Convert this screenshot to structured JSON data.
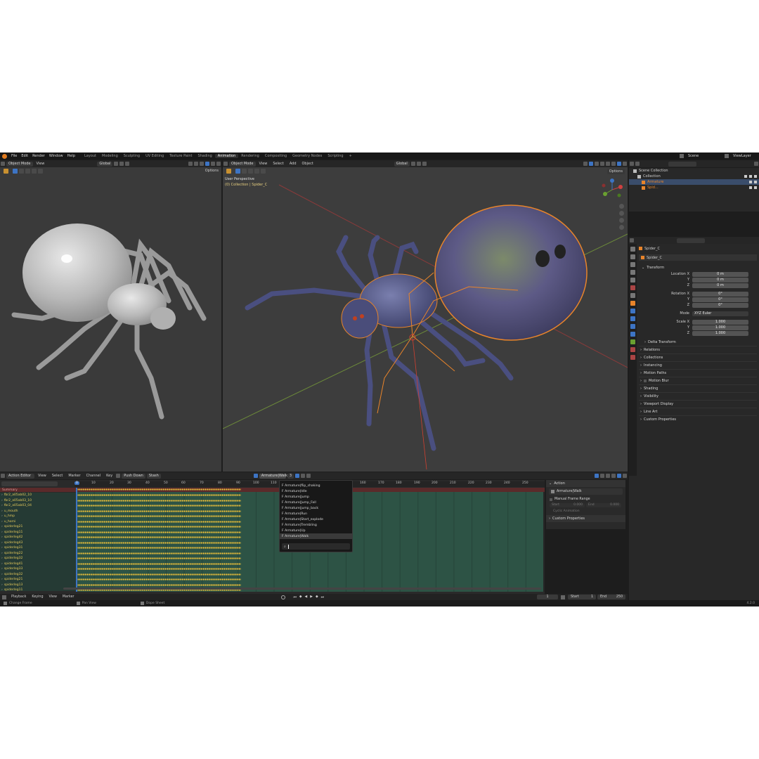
{
  "menu": {
    "items": [
      "File",
      "Edit",
      "Render",
      "Window",
      "Help"
    ],
    "workspaces": [
      "Layout",
      "Modeling",
      "Sculpting",
      "UV Editing",
      "Texture Paint",
      "Shading",
      "Animation",
      "Rendering",
      "Compositing",
      "Geometry Nodes",
      "Scripting"
    ],
    "active_workspace": "Animation",
    "scene_label": "Scene",
    "view_layer_label": "ViewLayer"
  },
  "left_view": {
    "mode": "Object Mode",
    "view_label": "View",
    "transform": "Global",
    "options": "Options"
  },
  "main_view": {
    "mode": "Object Mode",
    "menus": [
      "View",
      "Select",
      "Add",
      "Object"
    ],
    "transform": "Global",
    "options": "Options",
    "overlay_line1": "User Perspective",
    "overlay_line2": "(0) Collection | Spider_C"
  },
  "outliner": {
    "search_placeholder": "",
    "rows": [
      {
        "label": "Scene Collection",
        "indent": 0
      },
      {
        "label": "Collection",
        "indent": 1
      },
      {
        "label": "Armature",
        "indent": 2,
        "selected": true
      },
      {
        "label": "Spid...",
        "indent": 2
      }
    ]
  },
  "properties": {
    "object_name": "Spider_C",
    "object_name_field": "Spider_C",
    "transform_title": "Transform",
    "location": [
      {
        "label": "Location X",
        "value": "0 m"
      },
      {
        "label": "Y",
        "value": "0 m"
      },
      {
        "label": "Z",
        "value": "0 m"
      }
    ],
    "rotation": [
      {
        "label": "Rotation X",
        "value": "0°"
      },
      {
        "label": "Y",
        "value": "0°"
      },
      {
        "label": "Z",
        "value": "0°"
      }
    ],
    "mode_label": "Mode",
    "mode_value": "XYZ Euler",
    "scale": [
      {
        "label": "Scale X",
        "value": "1.000"
      },
      {
        "label": "Y",
        "value": "1.000"
      },
      {
        "label": "Z",
        "value": "1.000"
      }
    ],
    "delta_transform": "Delta Transform",
    "sections": [
      "Relations",
      "Collections",
      "Instancing",
      "Motion Paths",
      "Motion Blur",
      "Shading",
      "Visibility",
      "Viewport Display",
      "Line Art",
      "Custom Properties"
    ]
  },
  "action_editor": {
    "editor_label": "Action Editor",
    "menus": [
      "View",
      "Select",
      "Marker",
      "Channel",
      "Key"
    ],
    "push_down": "Push Down",
    "stash": "Stash",
    "action_name": "Armature|Walk",
    "users": "3",
    "summary_label": "Summary",
    "current_frame_marker": "0",
    "ticks": [
      "0",
      "10",
      "20",
      "30",
      "40",
      "50",
      "60",
      "70",
      "80",
      "90",
      "100",
      "110",
      "160",
      "170",
      "180",
      "190",
      "200",
      "210",
      "220",
      "230",
      "240",
      "250"
    ],
    "channels": [
      "fbr2_a05ab02_10",
      "fbr2_a05ab03_10",
      "fbr2_a05ab03_04",
      "u_mouth",
      "u_hmp",
      "u_horni",
      "spiderleg21",
      "spiderleg11",
      "spiderleg42",
      "spiderleg43",
      "spiderleg31",
      "spiderleg22",
      "spiderleg32",
      "spiderleg41",
      "spiderleg33",
      "spiderleg32",
      "spiderleg21",
      "spiderleg13",
      "spiderleg11"
    ]
  },
  "action_dropdown": {
    "items": [
      "F Armature|flip_shaking",
      "F Armature|Idle",
      "F Armature|Jump",
      "F Armature|Jump_Fall",
      "F Armature|jump_back",
      "F Armature|Run",
      "F Armature|Start_explode",
      "F Armature|Trembling",
      "F Armature|Up",
      "F Armature|Walk"
    ],
    "active_item": "F Armature|Walk",
    "search_placeholder": ""
  },
  "action_panel": {
    "title": "Action",
    "action_field": "Armature|Walk",
    "manual_range": "Manual Frame Range",
    "start_label": "Start",
    "start_value": "0.000",
    "end_label": "End",
    "end_value": "0.000",
    "cyclic": "Cyclic Animation",
    "custom_props": "Custom Properties"
  },
  "playback": {
    "menus": [
      "Playback",
      "Keying",
      "View",
      "Marker"
    ],
    "current_frame": "1",
    "start_label": "Start",
    "start_value": "1",
    "end_label": "End",
    "end_value": "250"
  },
  "status": {
    "left": "Change Frame",
    "middle": "Pan View",
    "right_hint": "Dope Sheet",
    "version": "4.2.0"
  },
  "colors": {
    "accent": "#3d74c4",
    "selection_outline": "#e8842a",
    "keyframe": "#f0c23a",
    "channel_text": "#e4c95b",
    "timeline_range": "#2e5a4a"
  }
}
